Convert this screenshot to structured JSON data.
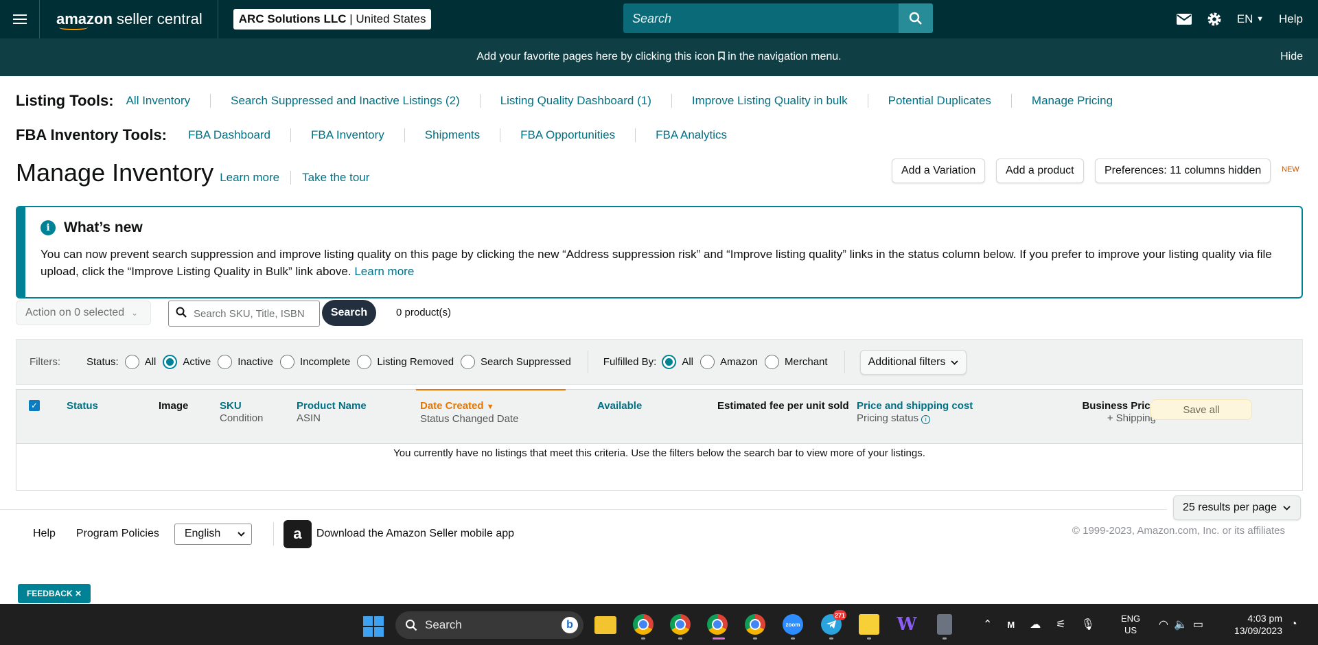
{
  "nav": {
    "logo_a": "amazon",
    "logo_b": "seller central",
    "account_name": "ARC Solutions LLC",
    "account_region": "United States",
    "search_placeholder": "Search",
    "language": "EN",
    "help": "Help"
  },
  "banner": {
    "message_a": "Add your favorite pages here by clicking this icon",
    "message_b": "in the navigation menu.",
    "hide": "Hide"
  },
  "listing_tools": {
    "title": "Listing Tools:",
    "links": [
      "All Inventory",
      "Search Suppressed and Inactive Listings (2)",
      "Listing Quality Dashboard (1)",
      "Improve Listing Quality in bulk",
      "Potential Duplicates",
      "Manage Pricing"
    ]
  },
  "fba_tools": {
    "title": "FBA Inventory Tools:",
    "links": [
      "FBA Dashboard",
      "FBA Inventory",
      "Shipments",
      "FBA Opportunities",
      "FBA Analytics"
    ]
  },
  "page": {
    "title": "Manage Inventory",
    "learn_more": "Learn more",
    "tour": "Take the tour",
    "add_variation": "Add a Variation",
    "add_product": "Add a product",
    "preferences": "Preferences: 11 columns hidden",
    "new_tag": "NEW"
  },
  "whats_new": {
    "title": "What’s new",
    "body": "You can now prevent search suppression and improve listing quality on this page by clicking the new “Address suppression risk” and “Improve listing quality” links in the status column below. If you prefer to improve your listing quality via file upload, click the “Improve Listing Quality in Bulk” link above.",
    "learn_more": "Learn more"
  },
  "actions": {
    "action_select": "Action on 0 selected",
    "search_placeholder": "Search SKU, Title, ISBN",
    "search_button": "Search",
    "product_count": "0 product(s)"
  },
  "filters": {
    "label": "Filters:",
    "status_label": "Status:",
    "status_options": [
      "All",
      "Active",
      "Inactive",
      "Incomplete",
      "Listing Removed",
      "Search Suppressed"
    ],
    "status_selected": "Active",
    "fulfilled_label": "Fulfilled By:",
    "fulfilled_options": [
      "All",
      "Amazon",
      "Merchant"
    ],
    "fulfilled_selected": "All",
    "additional": "Additional filters"
  },
  "table": {
    "status": "Status",
    "image": "Image",
    "sku": "SKU",
    "condition": "Condition",
    "product_name": "Product Name",
    "asin": "ASIN",
    "date_created": "Date Created",
    "status_changed": "Status Changed Date",
    "available": "Available",
    "est_fee": "Estimated fee per unit sold",
    "price_shipping": "Price and shipping cost",
    "pricing_status": "Pricing status",
    "business_price": "Business Price",
    "plus_shipping": "+ Shipping",
    "save_all": "Save all",
    "empty_message": "You currently have no listings that meet this criteria. Use the filters below the search bar to view more of your listings."
  },
  "pager": {
    "per_page": "25 results per page"
  },
  "footer": {
    "help": "Help",
    "policies": "Program Policies",
    "language": "English",
    "app": "Download the Amazon Seller mobile app",
    "copyright": "© 1999-2023, Amazon.com, Inc. or its affiliates"
  },
  "feedback": "FEEDBACK",
  "taskbar": {
    "search": "Search",
    "lang_a": "ENG",
    "lang_b": "US",
    "time": "4:03 pm",
    "date": "13/09/2023",
    "telegram_badge": "271"
  },
  "colors": {
    "nav_bg": "#002f36",
    "link": "#007185",
    "accent": "#008296",
    "sort": "#e77600"
  }
}
